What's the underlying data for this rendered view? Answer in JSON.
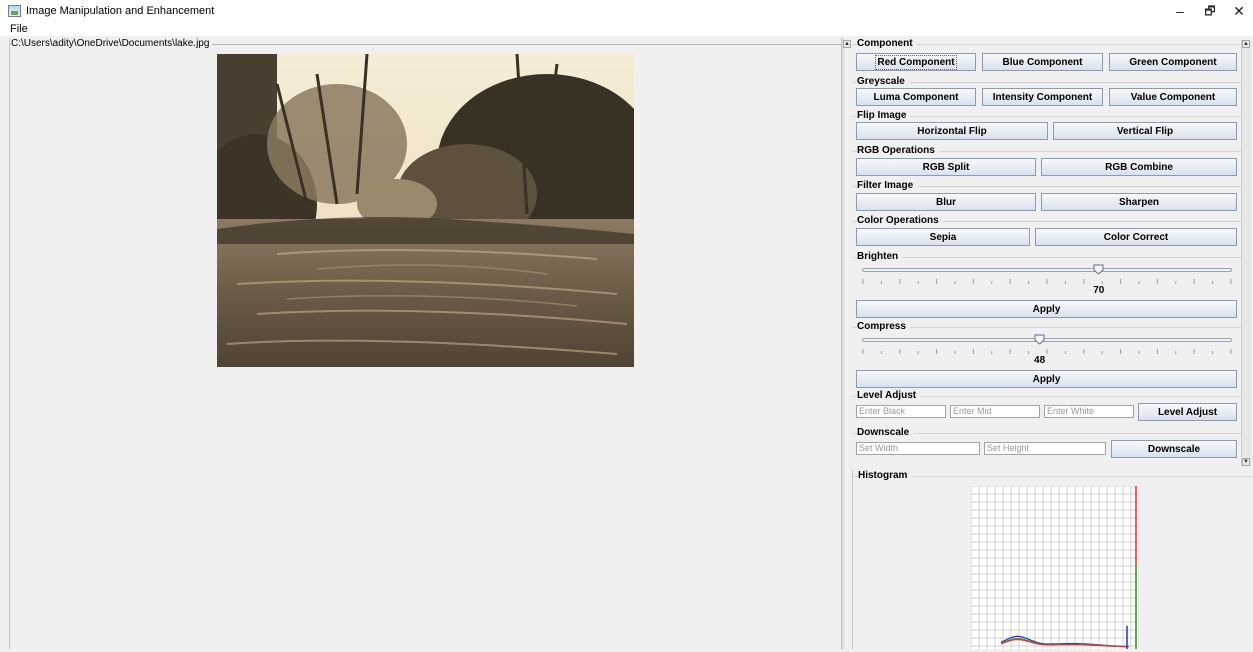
{
  "window": {
    "title": "Image Manipulation and Enhancement",
    "minimize": "–",
    "maximize": "🗗",
    "close": "✕"
  },
  "menu": {
    "file": "File"
  },
  "image_panel": {
    "path": "C:\\Users\\adity\\OneDrive\\Documents\\lake.jpg"
  },
  "sections": {
    "component": {
      "title": "Component",
      "red": "Red Component",
      "blue": "Blue Component",
      "green": "Green Component"
    },
    "greyscale": {
      "title": "Greyscale",
      "luma": "Luma Component",
      "intensity": "Intensity Component",
      "value": "Value Component"
    },
    "flip": {
      "title": "Flip Image",
      "horizontal": "Horizontal Flip",
      "vertical": "Vertical Flip"
    },
    "rgb": {
      "title": "RGB Operations",
      "split": "RGB Split",
      "combine": "RGB Combine"
    },
    "filter": {
      "title": "Filter Image",
      "blur": "Blur",
      "sharpen": "Sharpen"
    },
    "color": {
      "title": "Color Operations",
      "sepia": "Sepia",
      "correct": "Color Correct"
    },
    "brighten": {
      "title": "Brighten",
      "value": "70",
      "level": 0.64,
      "apply": "Apply"
    },
    "compress": {
      "title": "Compress",
      "value": "48",
      "level": 0.48,
      "apply": "Apply"
    },
    "level_adjust": {
      "title": "Level Adjust",
      "black_placeholder": "Enter Black",
      "mid_placeholder": "Enter Mid",
      "white_placeholder": "Enter White",
      "button": "Level Adjust"
    },
    "downscale": {
      "title": "Downscale",
      "width_placeholder": "Set Width",
      "height_placeholder": "Set Height",
      "button": "Downscale"
    }
  },
  "histogram": {
    "title": "Histogram",
    "colors": {
      "red": "#e03030",
      "green": "#30b030",
      "blue": "#2030d0",
      "intensity": "#888888"
    }
  }
}
